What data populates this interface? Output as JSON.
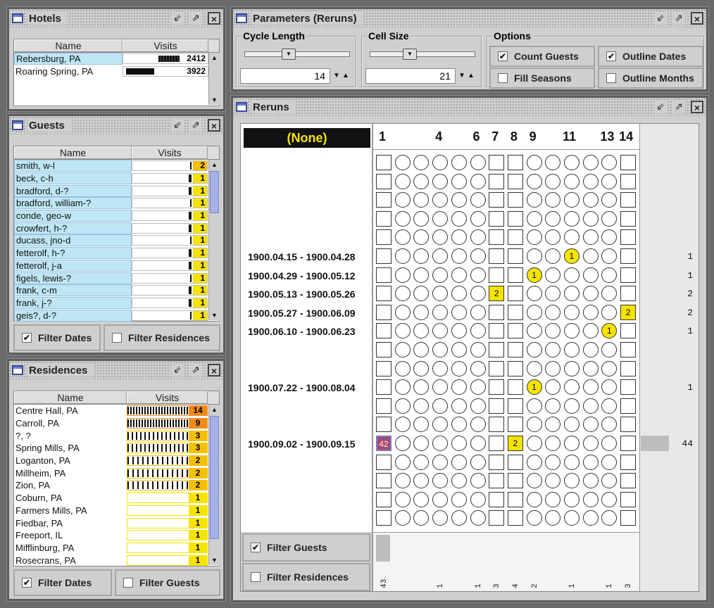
{
  "hotels": {
    "title": "Hotels",
    "col_name": "Name",
    "col_visits": "Visits",
    "rows": [
      {
        "name": "Rebersburg, PA",
        "visits": "2412"
      },
      {
        "name": "Roaring Spring, PA",
        "visits": "3922"
      }
    ]
  },
  "guests": {
    "title": "Guests",
    "col_name": "Name",
    "col_visits": "Visits",
    "filter_dates": "Filter Dates",
    "filter_residences": "Filter Residences",
    "rows": [
      {
        "name": "smith, w-l",
        "visits": "2"
      },
      {
        "name": "beck, c-h",
        "visits": "1"
      },
      {
        "name": "bradford, d-?",
        "visits": "1"
      },
      {
        "name": "bradford, william-?",
        "visits": "1"
      },
      {
        "name": "conde, geo-w",
        "visits": "1"
      },
      {
        "name": "crowfert, h-?",
        "visits": "1"
      },
      {
        "name": "ducass, jno-d",
        "visits": "1"
      },
      {
        "name": "fetterolf, h-?",
        "visits": "1"
      },
      {
        "name": "fetterolf, j-a",
        "visits": "1"
      },
      {
        "name": "figels, lewis-?",
        "visits": "1"
      },
      {
        "name": "frank, c-m",
        "visits": "1"
      },
      {
        "name": "frank, j-?",
        "visits": "1"
      },
      {
        "name": "geis?, d-?",
        "visits": "1"
      }
    ]
  },
  "residences": {
    "title": "Residences",
    "col_name": "Name",
    "col_visits": "Visits",
    "filter_dates": "Filter Dates",
    "filter_guests": "Filter Guests",
    "rows": [
      {
        "name": "Centre Hall, PA",
        "visits": "14",
        "color": "#f08a1a"
      },
      {
        "name": "Carroll, PA",
        "visits": "9",
        "color": "#f08a1a"
      },
      {
        "name": "?, ?",
        "visits": "3",
        "color": "#f5c000"
      },
      {
        "name": "Spring Mills, PA",
        "visits": "3",
        "color": "#f5c000"
      },
      {
        "name": "Loganton, PA",
        "visits": "2",
        "color": "#f5c000"
      },
      {
        "name": "Millheim, PA",
        "visits": "2",
        "color": "#f5c000"
      },
      {
        "name": "Zion, PA",
        "visits": "2",
        "color": "#f5c000"
      },
      {
        "name": "Coburn, PA",
        "visits": "1",
        "color": "#f5e400"
      },
      {
        "name": "Farmers Mills, PA",
        "visits": "1",
        "color": "#f5e400"
      },
      {
        "name": "Fiedbar, PA",
        "visits": "1",
        "color": "#f5e400"
      },
      {
        "name": "Freeport, IL",
        "visits": "1",
        "color": "#f5e400"
      },
      {
        "name": "Mifflinburg, PA",
        "visits": "1",
        "color": "#f5e400"
      },
      {
        "name": "Rosecrans, PA",
        "visits": "1",
        "color": "#f5e400"
      }
    ]
  },
  "params": {
    "title": "Parameters (Reruns)",
    "cycle_label": "Cycle Length",
    "cycle_value": "14",
    "cell_label": "Cell Size",
    "cell_value": "21",
    "options_label": "Options",
    "count_guests": "Count Guests",
    "outline_dates": "Outline Dates",
    "fill_seasons": "Fill Seasons",
    "outline_months": "Outline Months"
  },
  "reruns": {
    "title": "Reruns",
    "none_label": "(None)",
    "filter_guests": "Filter Guests",
    "filter_residences": "Filter Residences",
    "col_labels": [
      {
        "col": 1,
        "text": "1"
      },
      {
        "col": 4,
        "text": "4"
      },
      {
        "col": 6,
        "text": "6"
      },
      {
        "col": 7,
        "text": "7"
      },
      {
        "col": 8,
        "text": "8"
      },
      {
        "col": 9,
        "text": "9"
      },
      {
        "col": 11,
        "text": "11"
      },
      {
        "col": 13,
        "text": "13"
      },
      {
        "col": 14,
        "text": "14"
      }
    ],
    "row_labels": [
      {
        "row": 6,
        "text": "1900.04.15 - 1900.04.28"
      },
      {
        "row": 7,
        "text": "1900.04.29 - 1900.05.12"
      },
      {
        "row": 8,
        "text": "1900.05.13 - 1900.05.26"
      },
      {
        "row": 9,
        "text": "1900.05.27 - 1900.06.09"
      },
      {
        "row": 10,
        "text": "1900.06.10 - 1900.06.23"
      },
      {
        "row": 13,
        "text": "1900.07.22 - 1900.08.04"
      },
      {
        "row": 16,
        "text": "1900.09.02 - 1900.09.15"
      }
    ],
    "row_counts": [
      {
        "row": 6,
        "text": "1"
      },
      {
        "row": 7,
        "text": "1"
      },
      {
        "row": 8,
        "text": "2"
      },
      {
        "row": 9,
        "text": "2"
      },
      {
        "row": 10,
        "text": "1"
      },
      {
        "row": 13,
        "text": "1"
      },
      {
        "row": 16,
        "text": "44"
      }
    ],
    "col_counts": [
      {
        "col": 1,
        "text": "43"
      },
      {
        "col": 4,
        "text": "1"
      },
      {
        "col": 6,
        "text": "1"
      },
      {
        "col": 7,
        "text": "3"
      },
      {
        "col": 8,
        "text": "4"
      },
      {
        "col": 9,
        "text": "2"
      },
      {
        "col": 11,
        "text": "1"
      },
      {
        "col": 13,
        "text": "1"
      },
      {
        "col": 14,
        "text": "3"
      }
    ],
    "square_cols": [
      1,
      7,
      8,
      14
    ],
    "marks": [
      {
        "row": 6,
        "col": 11,
        "value": "1"
      },
      {
        "row": 7,
        "col": 9,
        "value": "1"
      },
      {
        "row": 8,
        "col": 7,
        "value": "2"
      },
      {
        "row": 9,
        "col": 14,
        "value": "2"
      },
      {
        "row": 10,
        "col": 13,
        "value": "1"
      },
      {
        "row": 13,
        "col": 9,
        "value": "1"
      },
      {
        "row": 16,
        "col": 1,
        "value": "42",
        "color": "#a8486a"
      },
      {
        "row": 16,
        "col": 8,
        "value": "2"
      }
    ]
  }
}
